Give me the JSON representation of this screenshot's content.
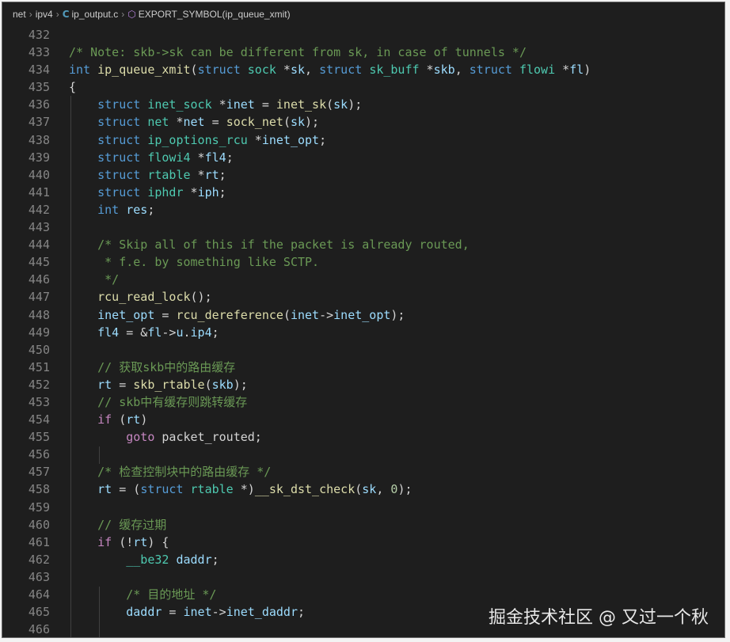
{
  "breadcrumb": {
    "items": [
      "net",
      "ipv4",
      "ip_output.c",
      "EXPORT_SYMBOL(ip_queue_xmit)"
    ],
    "file_icon": "C",
    "file_icon_name": "c-language-icon",
    "symbol_icon_name": "symbol-method-icon"
  },
  "editor": {
    "lines": [
      {
        "n": "432",
        "tokens": []
      },
      {
        "n": "433",
        "tokens": [
          [
            "cm",
            "/* Note: skb->sk can be different from sk, in case of tunnels */"
          ]
        ]
      },
      {
        "n": "434",
        "tokens": [
          [
            "kw",
            "int"
          ],
          [
            "pl",
            " "
          ],
          [
            "fn",
            "ip_queue_xmit"
          ],
          [
            "pl",
            "("
          ],
          [
            "kw",
            "struct"
          ],
          [
            "pl",
            " "
          ],
          [
            "ty",
            "sock"
          ],
          [
            "pl",
            " *"
          ],
          [
            "var",
            "sk"
          ],
          [
            "pl",
            ", "
          ],
          [
            "kw",
            "struct"
          ],
          [
            "pl",
            " "
          ],
          [
            "ty",
            "sk_buff"
          ],
          [
            "pl",
            " *"
          ],
          [
            "var",
            "skb"
          ],
          [
            "pl",
            ", "
          ],
          [
            "kw",
            "struct"
          ],
          [
            "pl",
            " "
          ],
          [
            "ty",
            "flowi"
          ],
          [
            "pl",
            " *"
          ],
          [
            "var",
            "fl"
          ],
          [
            "pl",
            ")"
          ]
        ]
      },
      {
        "n": "435",
        "tokens": [
          [
            "pl",
            "{"
          ]
        ]
      },
      {
        "n": "436",
        "tokens": [
          [
            "pl",
            "    "
          ],
          [
            "kw",
            "struct"
          ],
          [
            "pl",
            " "
          ],
          [
            "ty",
            "inet_sock"
          ],
          [
            "pl",
            " *"
          ],
          [
            "var",
            "inet"
          ],
          [
            "pl",
            " = "
          ],
          [
            "fn",
            "inet_sk"
          ],
          [
            "pl",
            "("
          ],
          [
            "var",
            "sk"
          ],
          [
            "pl",
            ");"
          ]
        ]
      },
      {
        "n": "437",
        "tokens": [
          [
            "pl",
            "    "
          ],
          [
            "kw",
            "struct"
          ],
          [
            "pl",
            " "
          ],
          [
            "ty",
            "net"
          ],
          [
            "pl",
            " *"
          ],
          [
            "var",
            "net"
          ],
          [
            "pl",
            " = "
          ],
          [
            "fn",
            "sock_net"
          ],
          [
            "pl",
            "("
          ],
          [
            "var",
            "sk"
          ],
          [
            "pl",
            ");"
          ]
        ]
      },
      {
        "n": "438",
        "tokens": [
          [
            "pl",
            "    "
          ],
          [
            "kw",
            "struct"
          ],
          [
            "pl",
            " "
          ],
          [
            "ty",
            "ip_options_rcu"
          ],
          [
            "pl",
            " *"
          ],
          [
            "var",
            "inet_opt"
          ],
          [
            "pl",
            ";"
          ]
        ]
      },
      {
        "n": "439",
        "tokens": [
          [
            "pl",
            "    "
          ],
          [
            "kw",
            "struct"
          ],
          [
            "pl",
            " "
          ],
          [
            "ty",
            "flowi4"
          ],
          [
            "pl",
            " *"
          ],
          [
            "var",
            "fl4"
          ],
          [
            "pl",
            ";"
          ]
        ]
      },
      {
        "n": "440",
        "tokens": [
          [
            "pl",
            "    "
          ],
          [
            "kw",
            "struct"
          ],
          [
            "pl",
            " "
          ],
          [
            "ty",
            "rtable"
          ],
          [
            "pl",
            " *"
          ],
          [
            "var",
            "rt"
          ],
          [
            "pl",
            ";"
          ]
        ]
      },
      {
        "n": "441",
        "tokens": [
          [
            "pl",
            "    "
          ],
          [
            "kw",
            "struct"
          ],
          [
            "pl",
            " "
          ],
          [
            "ty",
            "iphdr"
          ],
          [
            "pl",
            " *"
          ],
          [
            "var",
            "iph"
          ],
          [
            "pl",
            ";"
          ]
        ]
      },
      {
        "n": "442",
        "tokens": [
          [
            "pl",
            "    "
          ],
          [
            "kw",
            "int"
          ],
          [
            "pl",
            " "
          ],
          [
            "var",
            "res"
          ],
          [
            "pl",
            ";"
          ]
        ]
      },
      {
        "n": "443",
        "tokens": []
      },
      {
        "n": "444",
        "tokens": [
          [
            "pl",
            "    "
          ],
          [
            "cm",
            "/* Skip all of this if the packet is already routed,"
          ]
        ]
      },
      {
        "n": "445",
        "tokens": [
          [
            "pl",
            "    "
          ],
          [
            "cm",
            " * f.e. by something like SCTP."
          ]
        ]
      },
      {
        "n": "446",
        "tokens": [
          [
            "pl",
            "    "
          ],
          [
            "cm",
            " */"
          ]
        ]
      },
      {
        "n": "447",
        "tokens": [
          [
            "pl",
            "    "
          ],
          [
            "fn",
            "rcu_read_lock"
          ],
          [
            "pl",
            "();"
          ]
        ]
      },
      {
        "n": "448",
        "tokens": [
          [
            "pl",
            "    "
          ],
          [
            "var",
            "inet_opt"
          ],
          [
            "pl",
            " = "
          ],
          [
            "fn",
            "rcu_dereference"
          ],
          [
            "pl",
            "("
          ],
          [
            "var",
            "inet"
          ],
          [
            "pl",
            "->"
          ],
          [
            "var",
            "inet_opt"
          ],
          [
            "pl",
            ");"
          ]
        ]
      },
      {
        "n": "449",
        "tokens": [
          [
            "pl",
            "    "
          ],
          [
            "var",
            "fl4"
          ],
          [
            "pl",
            " = &"
          ],
          [
            "var",
            "fl"
          ],
          [
            "pl",
            "->"
          ],
          [
            "var",
            "u"
          ],
          [
            "pl",
            "."
          ],
          [
            "var",
            "ip4"
          ],
          [
            "pl",
            ";"
          ]
        ]
      },
      {
        "n": "450",
        "tokens": []
      },
      {
        "n": "451",
        "tokens": [
          [
            "pl",
            "    "
          ],
          [
            "cm",
            "// 获取skb中的路由缓存"
          ]
        ]
      },
      {
        "n": "452",
        "tokens": [
          [
            "pl",
            "    "
          ],
          [
            "var",
            "rt"
          ],
          [
            "pl",
            " = "
          ],
          [
            "fn",
            "skb_rtable"
          ],
          [
            "pl",
            "("
          ],
          [
            "var",
            "skb"
          ],
          [
            "pl",
            ");"
          ]
        ]
      },
      {
        "n": "453",
        "tokens": [
          [
            "pl",
            "    "
          ],
          [
            "cm",
            "// skb中有缓存则跳转缓存"
          ]
        ]
      },
      {
        "n": "454",
        "tokens": [
          [
            "pl",
            "    "
          ],
          [
            "ctl",
            "if"
          ],
          [
            "pl",
            " ("
          ],
          [
            "var",
            "rt"
          ],
          [
            "pl",
            ")"
          ]
        ]
      },
      {
        "n": "455",
        "tokens": [
          [
            "pl",
            "        "
          ],
          [
            "ctl",
            "goto"
          ],
          [
            "pl",
            " packet_routed;"
          ]
        ]
      },
      {
        "n": "456",
        "tokens": []
      },
      {
        "n": "457",
        "tokens": [
          [
            "pl",
            "    "
          ],
          [
            "cm",
            "/* 检查控制块中的路由缓存 */"
          ]
        ]
      },
      {
        "n": "458",
        "tokens": [
          [
            "pl",
            "    "
          ],
          [
            "var",
            "rt"
          ],
          [
            "pl",
            " = ("
          ],
          [
            "kw",
            "struct"
          ],
          [
            "pl",
            " "
          ],
          [
            "ty",
            "rtable"
          ],
          [
            "pl",
            " *)"
          ],
          [
            "fn",
            "__sk_dst_check"
          ],
          [
            "pl",
            "("
          ],
          [
            "var",
            "sk"
          ],
          [
            "pl",
            ", "
          ],
          [
            "num",
            "0"
          ],
          [
            "pl",
            ");"
          ]
        ]
      },
      {
        "n": "459",
        "tokens": []
      },
      {
        "n": "460",
        "tokens": [
          [
            "pl",
            "    "
          ],
          [
            "cm",
            "// 缓存过期"
          ]
        ]
      },
      {
        "n": "461",
        "tokens": [
          [
            "pl",
            "    "
          ],
          [
            "ctl",
            "if"
          ],
          [
            "pl",
            " (!"
          ],
          [
            "var",
            "rt"
          ],
          [
            "pl",
            ") {"
          ]
        ]
      },
      {
        "n": "462",
        "tokens": [
          [
            "pl",
            "        "
          ],
          [
            "ty",
            "__be32"
          ],
          [
            "pl",
            " "
          ],
          [
            "var",
            "daddr"
          ],
          [
            "pl",
            ";"
          ]
        ]
      },
      {
        "n": "463",
        "tokens": []
      },
      {
        "n": "464",
        "tokens": [
          [
            "pl",
            "        "
          ],
          [
            "cm",
            "/* 目的地址 */"
          ]
        ]
      },
      {
        "n": "465",
        "tokens": [
          [
            "pl",
            "        "
          ],
          [
            "var",
            "daddr"
          ],
          [
            "pl",
            " = "
          ],
          [
            "var",
            "inet"
          ],
          [
            "pl",
            "->"
          ],
          [
            "var",
            "inet_daddr"
          ],
          [
            "pl",
            ";"
          ]
        ]
      },
      {
        "n": "466",
        "tokens": []
      }
    ]
  },
  "watermark": {
    "text": "掘金技术社区 @ 又过一个秋"
  }
}
